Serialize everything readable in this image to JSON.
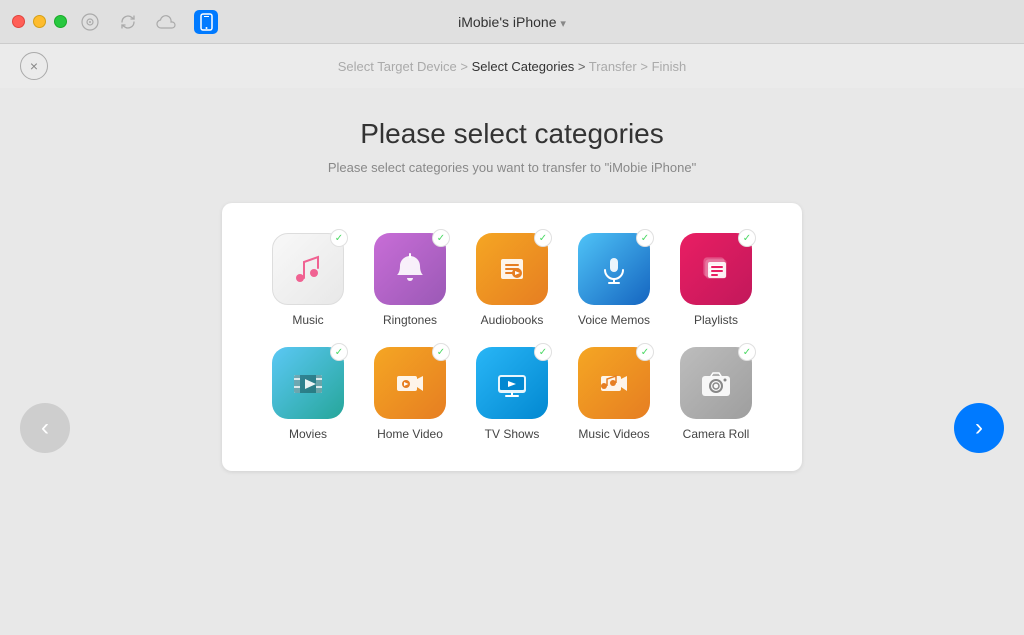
{
  "titleBar": {
    "title": "iMobie's iPhone",
    "arrow": "▾"
  },
  "breadcrumb": {
    "step1": "Select Target Device",
    "sep1": " > ",
    "step2": "Select Categories",
    "sep2": " > ",
    "step3": "Transfer",
    "sep3": " > ",
    "step4": "Finish"
  },
  "close": "×",
  "heading": "Please select categories",
  "subheading": "Please select categories you want to transfer to \"iMobie iPhone\"",
  "categories": [
    {
      "id": "music",
      "label": "Music",
      "checked": true,
      "iconType": "music"
    },
    {
      "id": "ringtones",
      "label": "Ringtones",
      "checked": true,
      "iconType": "ringtones"
    },
    {
      "id": "audiobooks",
      "label": "Audiobooks",
      "checked": true,
      "iconType": "audiobooks"
    },
    {
      "id": "voicememos",
      "label": "Voice Memos",
      "checked": true,
      "iconType": "voicememos"
    },
    {
      "id": "playlists",
      "label": "Playlists",
      "checked": true,
      "iconType": "playlists"
    },
    {
      "id": "movies",
      "label": "Movies",
      "checked": true,
      "iconType": "movies"
    },
    {
      "id": "homevideo",
      "label": "Home Video",
      "checked": true,
      "iconType": "homevideo"
    },
    {
      "id": "tvshows",
      "label": "TV Shows",
      "checked": true,
      "iconType": "tvshows"
    },
    {
      "id": "musicvideos",
      "label": "Music Videos",
      "checked": true,
      "iconType": "musicvideos"
    },
    {
      "id": "cameraroll",
      "label": "Camera Roll",
      "checked": true,
      "iconType": "cameraroll"
    }
  ],
  "navLeft": "‹",
  "navRight": "›"
}
